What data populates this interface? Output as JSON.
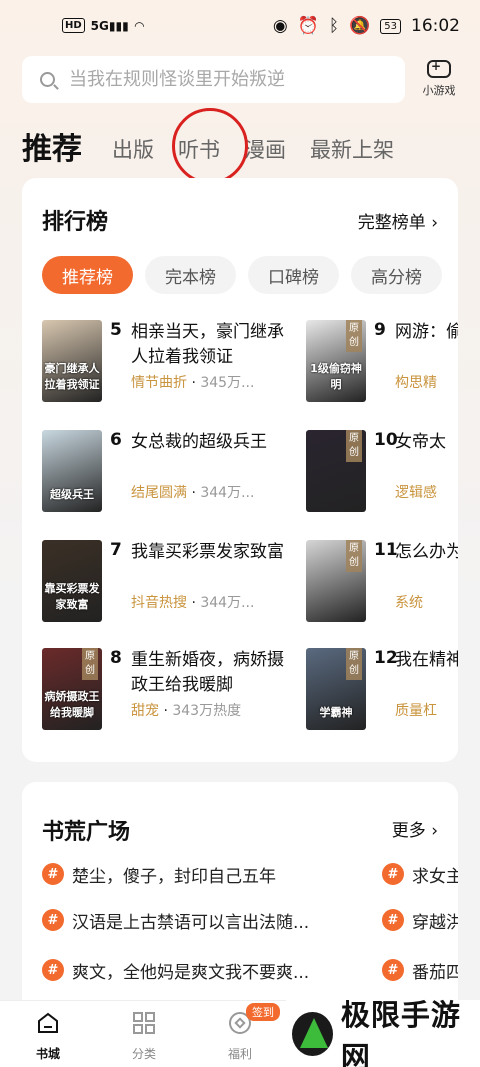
{
  "status_bar": {
    "hd": "HD",
    "signal": "5G",
    "battery": "53",
    "time": "16:02"
  },
  "search": {
    "placeholder": "当我在规则怪谈里开始叛逆",
    "game_label": "小游戏"
  },
  "tabs": [
    "推荐",
    "出版",
    "听书",
    "漫画",
    "最新上架"
  ],
  "ranking": {
    "title": "排行榜",
    "more": "完整榜单 ›",
    "chips": [
      "推荐榜",
      "完本榜",
      "口碑榜",
      "高分榜"
    ],
    "books": [
      {
        "num": "5",
        "title": "相亲当天，豪门继承人拉着我领证",
        "tag": "情节曲折",
        "heat": "345万...",
        "cover_text": "豪门继承人拉着我领证",
        "cover_color": "#d8c7b0",
        "badge": ""
      },
      {
        "num": "6",
        "title": "女总裁的超级兵王",
        "tag": "结尾圆满",
        "heat": "344万...",
        "cover_text": "超级兵王",
        "cover_color": "#c9d8e0",
        "badge": ""
      },
      {
        "num": "7",
        "title": "我靠买彩票发家致富",
        "tag": "抖音热搜",
        "heat": "344万...",
        "cover_text": "靠买彩票发家致富",
        "cover_color": "#3b3026",
        "badge": ""
      },
      {
        "num": "8",
        "title": "重生新婚夜，病娇摄政王给我暖脚",
        "tag": "甜宠",
        "heat": "343万热度",
        "cover_text": "病娇摄政王给我暖脚",
        "cover_color": "#6b2a2a",
        "badge": "原创"
      },
      {
        "num": "9",
        "title": "网游：偷窃神",
        "tag": "构思精",
        "heat": "",
        "cover_text": "1级偷窃神明",
        "cover_color": "#e8e8e8",
        "badge": "原创"
      },
      {
        "num": "10",
        "title": "女帝太",
        "tag": "逻辑感",
        "heat": "",
        "cover_text": "",
        "cover_color": "#2a2530",
        "badge": "原创"
      },
      {
        "num": "11",
        "title": "怎么办为我和",
        "tag": "系统",
        "heat": "",
        "cover_text": "",
        "cover_color": "#d6d6d6",
        "badge": "原创"
      },
      {
        "num": "12",
        "title": "我在精神",
        "tag": "质量杠",
        "heat": "",
        "cover_text": "学霸神",
        "cover_color": "#5a6a80",
        "badge": "原创"
      }
    ]
  },
  "square": {
    "title": "书荒广场",
    "more": "更多 ›",
    "topics_left": [
      "楚尘，傻子，封印自己五年",
      "汉语是上古禁语可以言出法随...",
      "爽文，全他妈是爽文我不要爽..."
    ],
    "topics_right": [
      "求女主",
      "穿越洪",
      "番茄四"
    ]
  },
  "nav": {
    "items": [
      "书城",
      "分类",
      "福利"
    ],
    "sign_badge": "签到"
  },
  "watermark": "极限手游网"
}
